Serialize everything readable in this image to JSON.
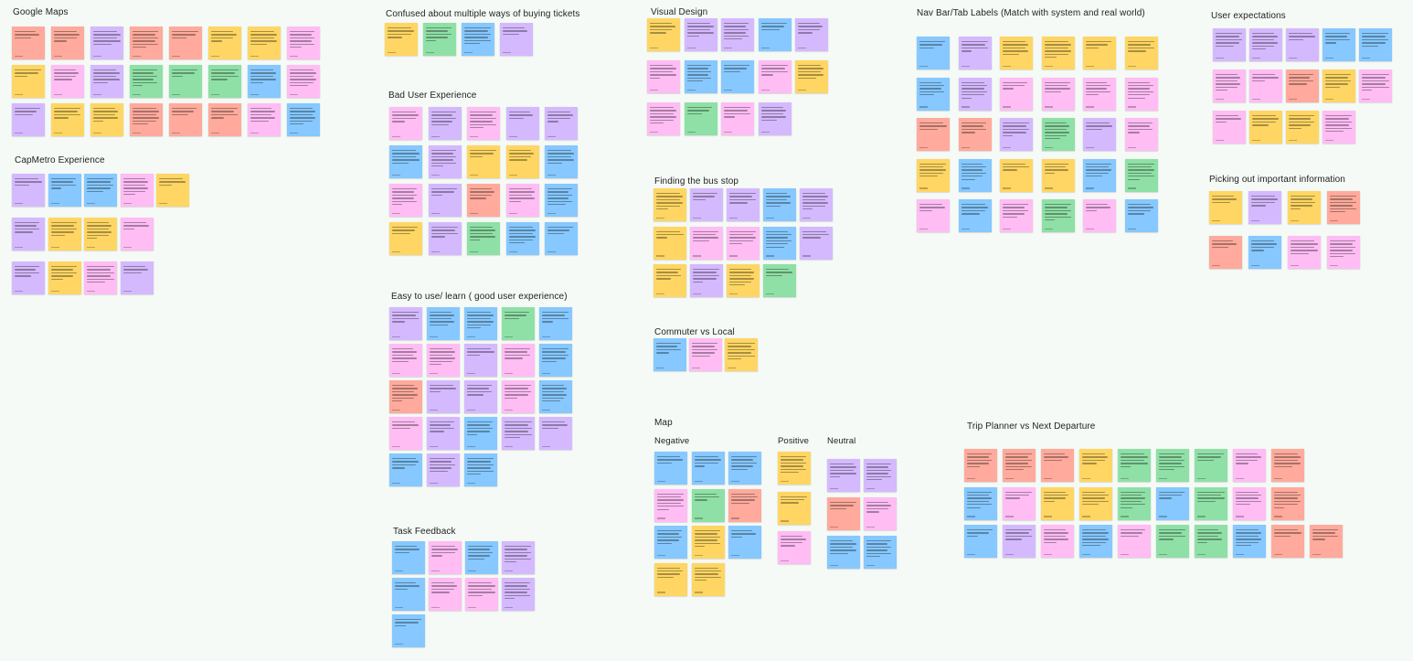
{
  "colors": {
    "background": "#f5faf6",
    "purple": "#d5b9ff",
    "blue": "#86c8ff",
    "yellow": "#ffd663",
    "salmon": "#ffaa9c",
    "pink": "#ffbdf4",
    "green": "#8fe0a6"
  },
  "sections": {
    "google_maps": "Google Maps",
    "capmetro": "CapMetro Experience",
    "confused_tickets": "Confused about multiple ways of buying tickets",
    "bad_ux": "Bad User Experience",
    "easy_to_use": "Easy to use/ learn ( good user experience)",
    "task_feedback": "Task Feedback",
    "visual_design": "Visual Design",
    "finding_bus_stop": "Finding the bus stop",
    "commuter_vs_local": "Commuter vs Local",
    "map": "Map",
    "map_negative": "Negative",
    "map_positive": "Positive",
    "map_neutral": "Neutral",
    "nav_bar": "Nav Bar/Tab Labels (Match with system and real world)",
    "trip_planner": "Trip Planner vs Next Departure",
    "user_expectations": "User expectations",
    "important_info": "Picking out important information"
  }
}
